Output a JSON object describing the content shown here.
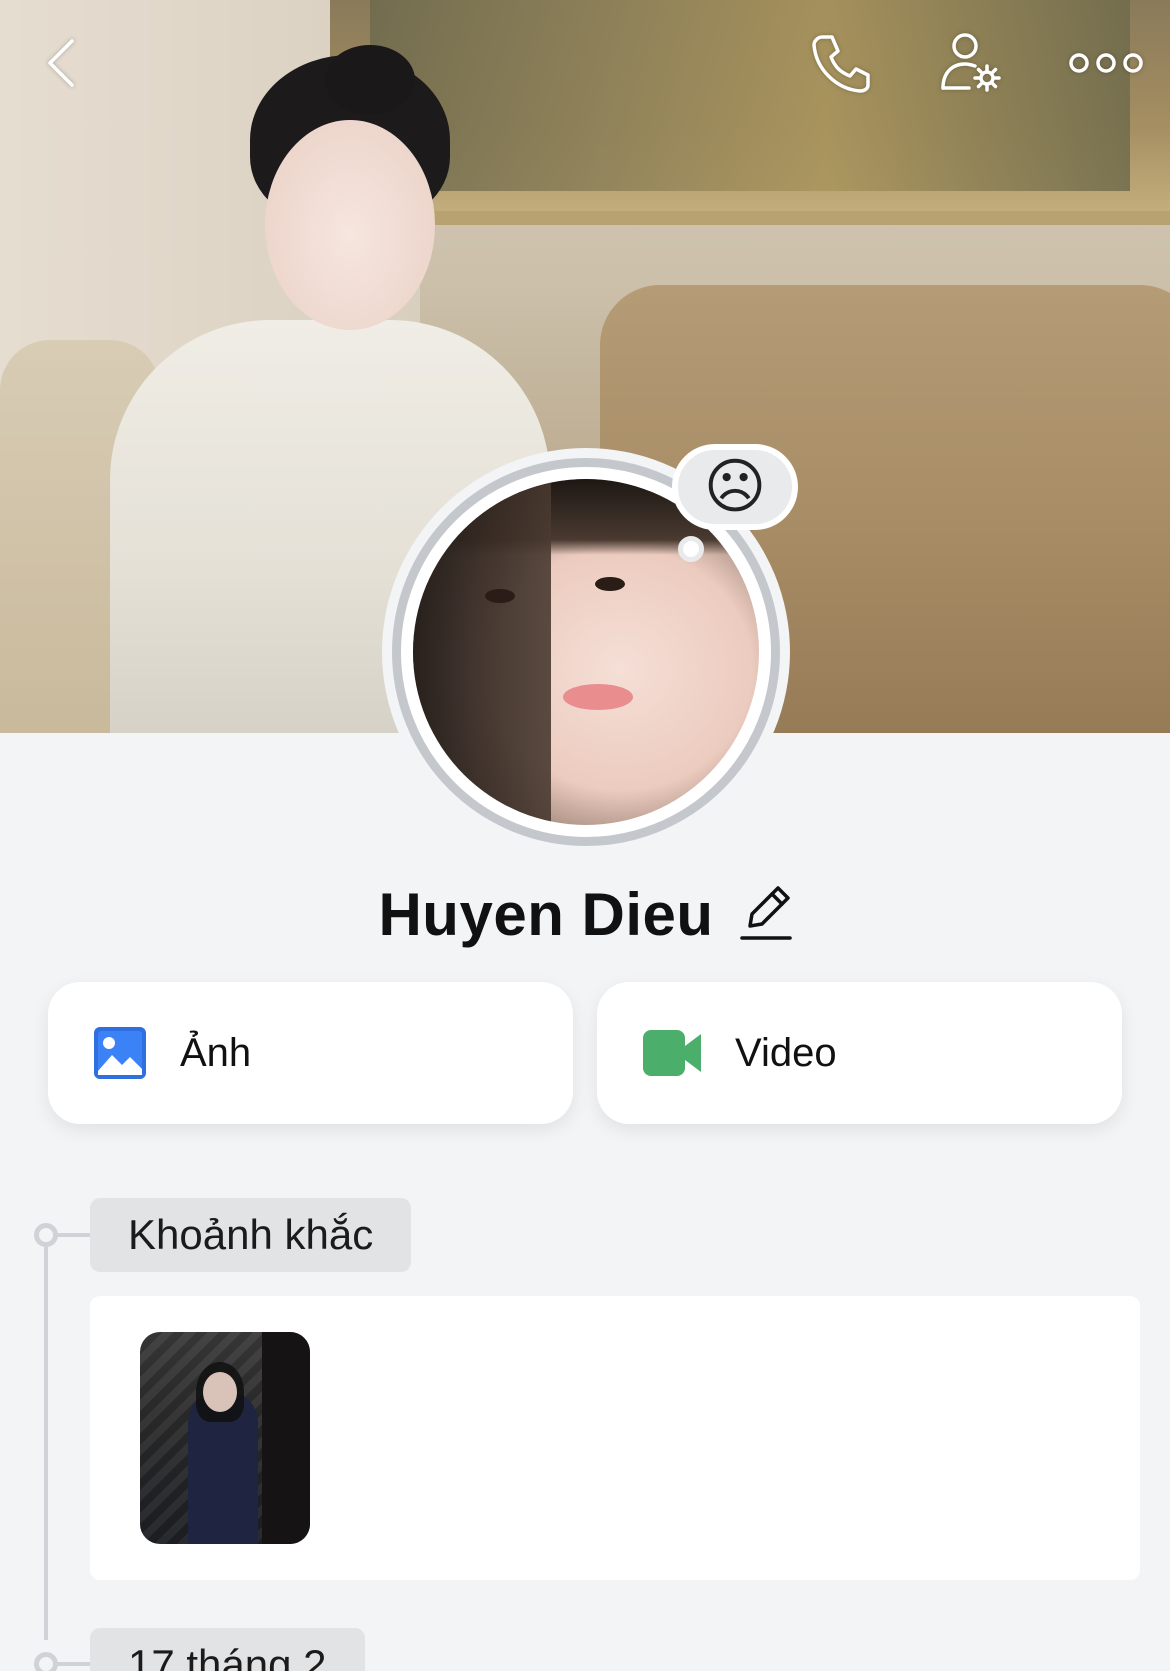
{
  "header": {
    "back_icon": "chevron-left-icon",
    "call_icon": "phone-icon",
    "settings_icon": "user-settings-icon",
    "more_icon": "more-dots-icon"
  },
  "profile": {
    "name": "Huyen Dieu",
    "mood_icon": "sad-face-icon",
    "mood_glyph": "☹"
  },
  "media": {
    "photo_label": "Ảnh",
    "video_label": "Video",
    "photo_icon_color": "#2f6fe0",
    "video_icon_color": "#4cae6b"
  },
  "timeline": {
    "moments_label": "Khoảnh khắc",
    "next_date_label": "17 tháng 2"
  }
}
